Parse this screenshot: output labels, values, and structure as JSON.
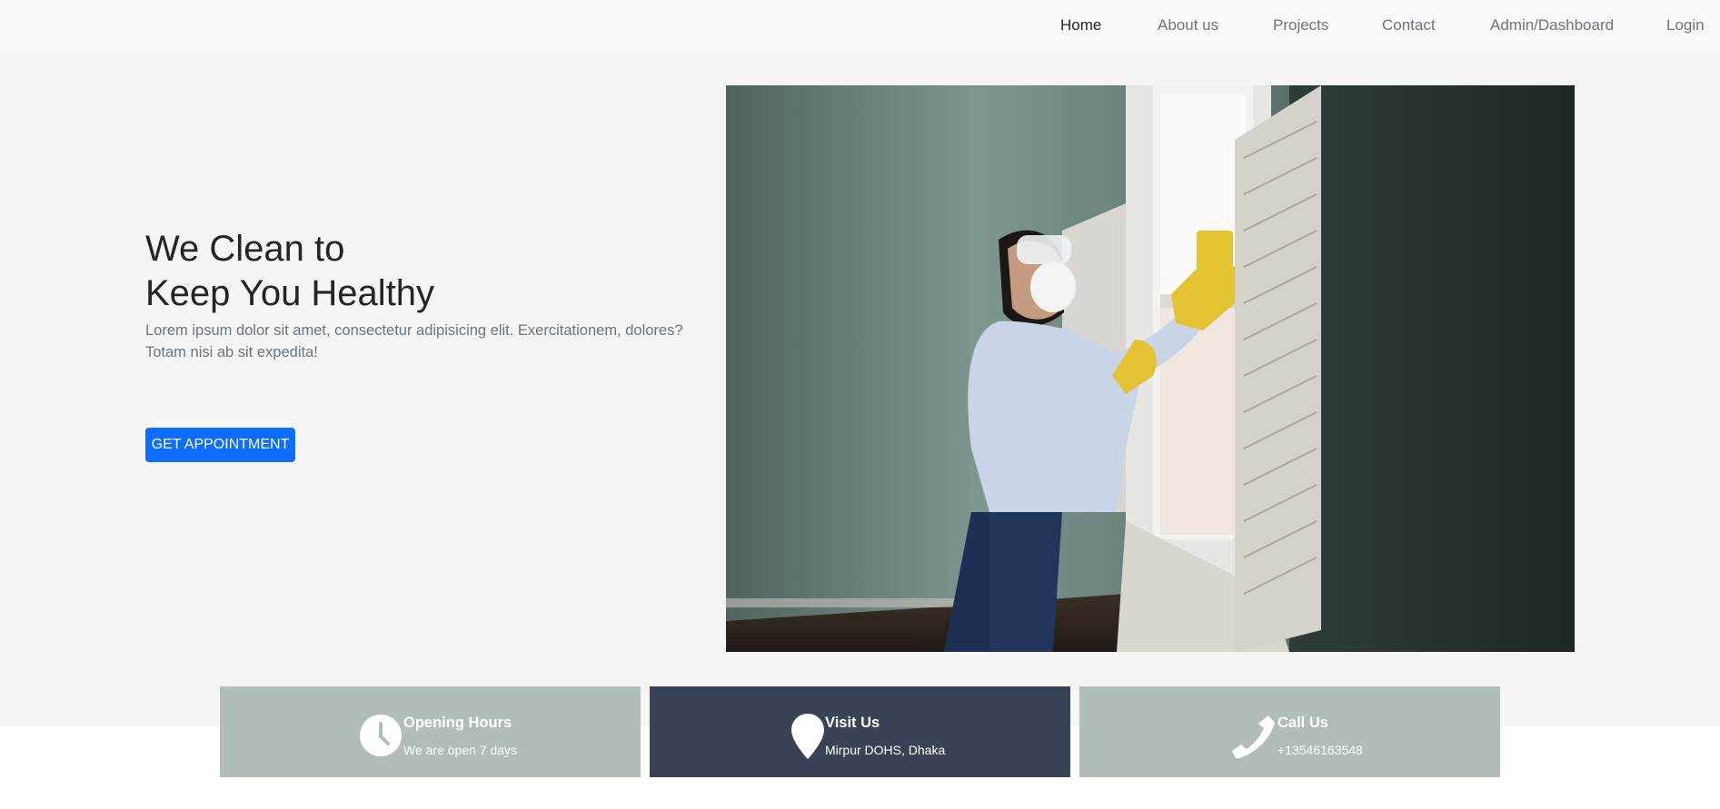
{
  "nav": {
    "items": [
      {
        "label": "Home",
        "active": true
      },
      {
        "label": "About us",
        "active": false
      },
      {
        "label": "Projects",
        "active": false
      },
      {
        "label": "Contact",
        "active": false
      },
      {
        "label": "Admin/Dashboard",
        "active": false
      },
      {
        "label": "Login",
        "active": false
      }
    ]
  },
  "hero": {
    "title_line1": "We Clean to",
    "title_line2": "Keep You Healthy",
    "description": "Lorem ipsum dolor sit amet, consectetur adipisicing elit. Exercitationem, dolores? Totam nisi ab sit expedita!",
    "cta_label": "GET APPOINTMENT"
  },
  "cards": [
    {
      "title": "Opening Hours",
      "detail": "We are open 7 days",
      "icon": "clock-icon"
    },
    {
      "title": "Visit Us",
      "detail": "Mirpur DOHS, Dhaka",
      "icon": "map-pin-icon"
    },
    {
      "title": "Call Us",
      "detail": "+13546163548",
      "icon": "phone-icon"
    }
  ],
  "colors": {
    "navbar_bg": "#f8f9fa",
    "hero_bg": "#f5f5f5",
    "primary": "#0d6efd",
    "card_sage": "#b2beb5",
    "card_slate": "#3a4255"
  }
}
